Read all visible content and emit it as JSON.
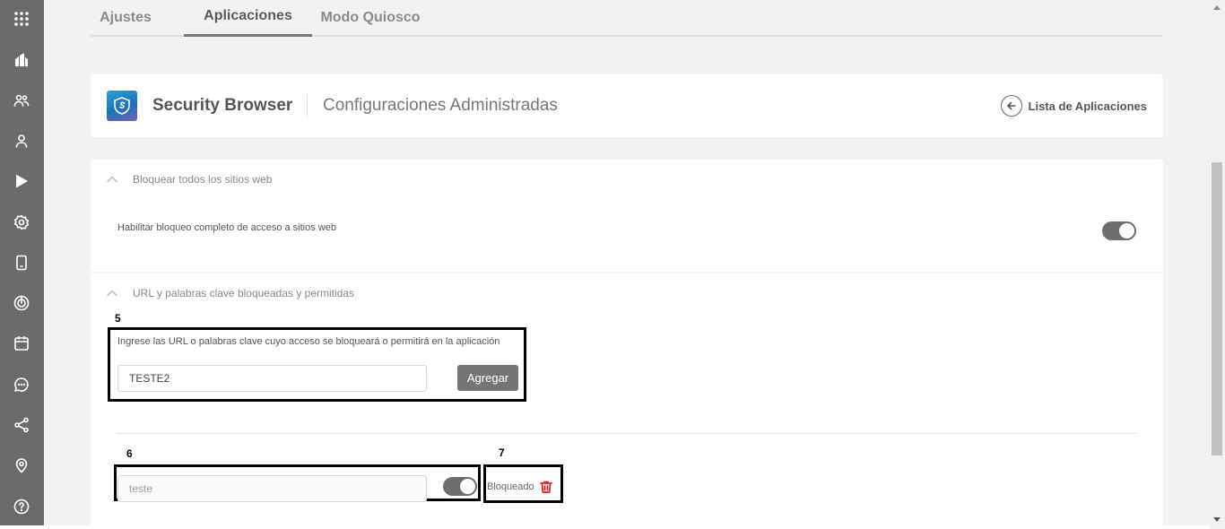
{
  "tabs": [
    {
      "label": "Ajustes",
      "active": false
    },
    {
      "label": "Aplicaciones",
      "active": true
    },
    {
      "label": "Modo Quiosco",
      "active": false
    }
  ],
  "sidebar": {
    "icons": [
      "apps-grid-icon",
      "dashboard-icon",
      "groups-icon",
      "user-icon",
      "play-store-icon",
      "settings-icon",
      "device-icon",
      "radar-icon",
      "calendar-icon",
      "chat-icon",
      "share-icon",
      "location-icon",
      "help-icon"
    ]
  },
  "header": {
    "app_name": "Security Browser",
    "subtitle": "Configuraciones Administradas",
    "back_label": "Lista de Aplicaciones",
    "logo_icon": "shield-icon"
  },
  "section_block": {
    "title": "Bloquear todos los sitios web",
    "toggle_label": "Habilitar bloqueo completo de acceso a sitios web",
    "toggle_on": true
  },
  "section_urls": {
    "title": "URL y palabras clave bloqueadas y permitidas",
    "instruction": "Ingrese las URL o palabras clave cuyo acceso se bloqueará o permitirá en la aplicación",
    "input_value": "TESTE2",
    "add_label": "Agregar",
    "entries": [
      {
        "value": "teste",
        "blocked": true,
        "status": "Bloqueado"
      }
    ]
  },
  "annotations": {
    "box5": "5",
    "box6": "6",
    "box7": "7"
  },
  "colors": {
    "sidebar": "#6b6b6b",
    "toggle": "#6e6e6e",
    "button": "#757575",
    "delete": "#e02424"
  }
}
